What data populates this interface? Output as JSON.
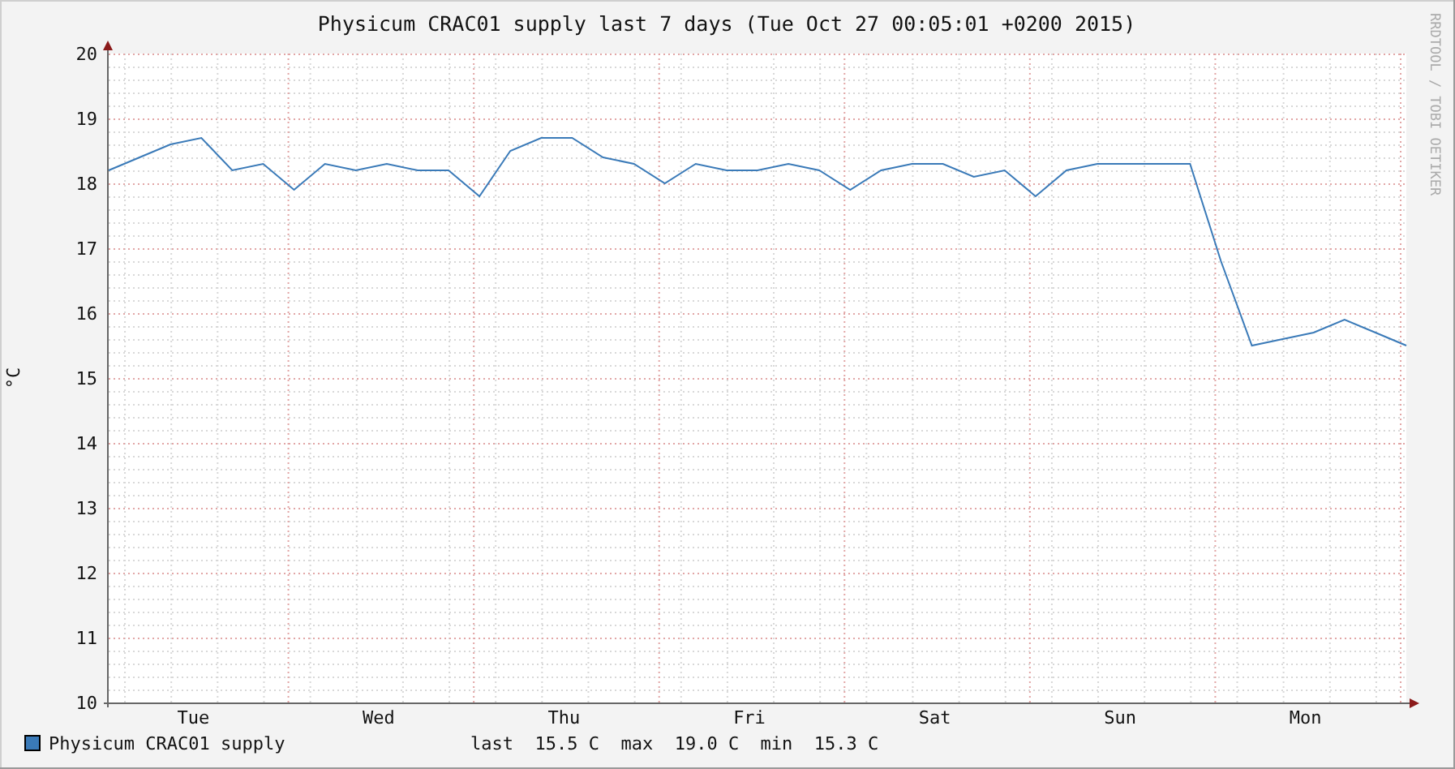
{
  "chart_data": {
    "type": "line",
    "title": "Physicum CRAC01 supply last 7 days (Tue Oct 27 00:05:01 +0200 2015)",
    "ylabel": "°C",
    "categories": [
      null,
      null,
      null,
      "Tue",
      null,
      null,
      null,
      null,
      null,
      "Wed",
      null,
      null,
      null,
      null,
      null,
      "Thu",
      null,
      null,
      null,
      null,
      null,
      "Fri",
      null,
      null,
      null,
      null,
      null,
      "Sat",
      null,
      null,
      null,
      null,
      null,
      "Sun",
      null,
      null,
      null,
      null,
      null,
      "Mon",
      null,
      null,
      null
    ],
    "series": [
      {
        "name": "Physicum CRAC01 supply",
        "color": "#3a7ab8",
        "values": [
          18.2,
          18.4,
          18.6,
          18.7,
          18.2,
          18.3,
          17.9,
          18.3,
          18.2,
          18.3,
          18.2,
          18.2,
          17.8,
          18.5,
          18.7,
          18.7,
          18.4,
          18.3,
          18.0,
          18.3,
          18.2,
          18.2,
          18.3,
          18.2,
          17.9,
          18.2,
          18.3,
          18.3,
          18.1,
          18.2,
          17.8,
          18.2,
          18.3,
          18.3,
          18.3,
          18.3,
          16.8,
          15.5,
          15.6,
          15.7,
          15.9,
          15.7,
          15.5
        ]
      }
    ],
    "ylim": [
      10,
      20
    ],
    "grid": true,
    "yticks": [
      10,
      11,
      12,
      13,
      14,
      15,
      16,
      17,
      18,
      19,
      20
    ]
  },
  "legend": {
    "stats": "last  15.5 C  max  19.0 C  min  15.3 C"
  },
  "credit": "RRDTOOL / TOBI OETIKER"
}
